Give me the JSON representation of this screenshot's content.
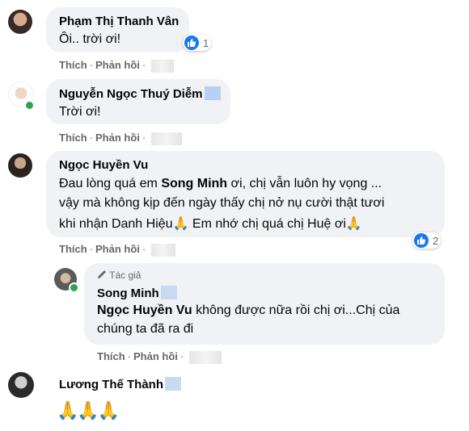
{
  "comments": [
    {
      "author": "Phạm Thị Thanh Vân",
      "text": "Ôi.. trời ơi!",
      "like_label": "Thích",
      "reply_label": "Phản hồi",
      "reaction_count": "1"
    },
    {
      "author": "Nguyễn Ngọc Thuý Diễm",
      "text": "Trời ơi!",
      "like_label": "Thích",
      "reply_label": "Phản hồi"
    },
    {
      "author": "Ngọc Huyền Vu",
      "line1_pre": "Đau lòng quá em ",
      "line1_tag": "Song Minh",
      "line1_post": " ơi, chị vẫn luôn hy vọng ...",
      "line2": "vậy mà không kịp đến ngày thấy chị nở nụ cười thật tươi",
      "line3_a": "khi nhận Danh Hiệu",
      "line3_b": " Em nhớ chị quá chị Huệ ơi",
      "like_label": "Thích",
      "reply_label": "Phản hồi",
      "reaction_count": "2"
    },
    {
      "badge": "Tác giả",
      "author": "Song Minh",
      "tag": "Ngọc Huyền Vu",
      "line1_post": " không được nữa rồi chị ơi...Chị của",
      "line2": "chúng ta đã ra đi",
      "like_label": "Thích",
      "reply_label": "Phản hồi"
    },
    {
      "author": "Lương Thế Thành",
      "emoji": "🙏🙏🙏"
    }
  ],
  "colors": {
    "bubble": "#f0f2f5",
    "action_text": "#65676b",
    "like_blue": "#1877f2",
    "online_green": "#31a24c"
  }
}
